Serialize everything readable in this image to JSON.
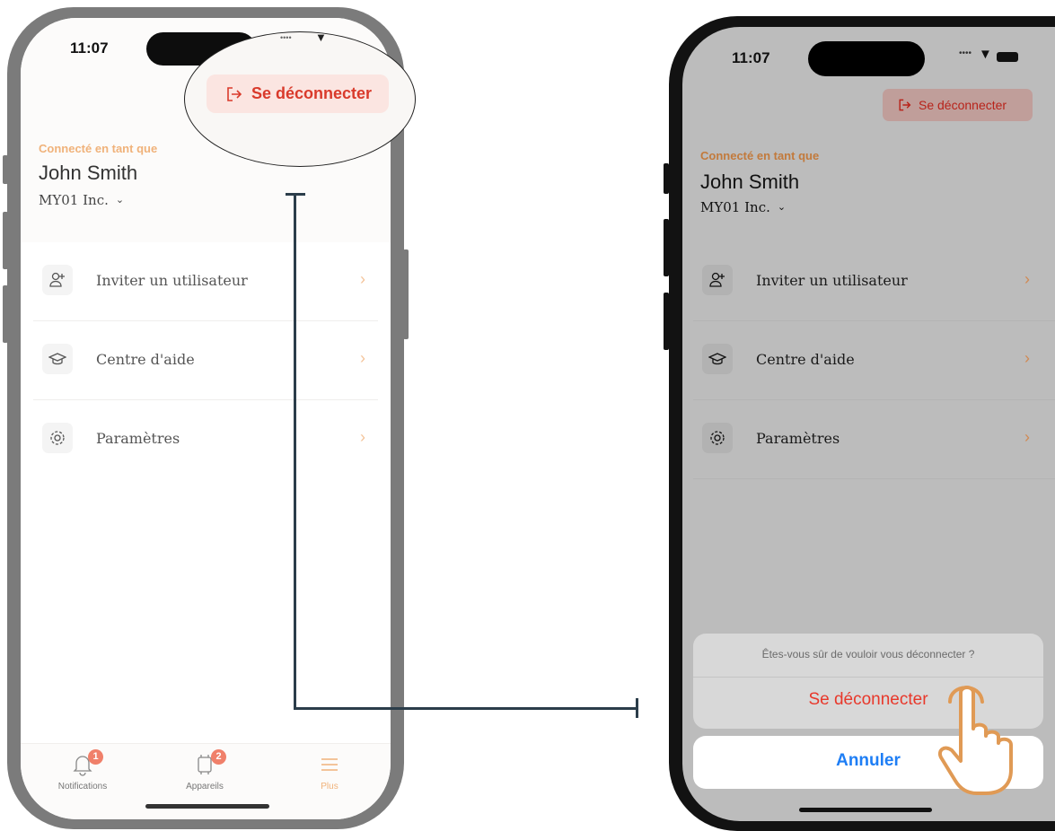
{
  "left_screen": {
    "status_time": "11:07",
    "logout_label": "Se déconnecter",
    "connected_label": "Connecté en tant que",
    "user_name": "John Smith",
    "org_name": "MY01 Inc.",
    "menu": [
      {
        "label": "Inviter un utilisateur",
        "icon": "add-user-icon"
      },
      {
        "label": "Centre d'aide",
        "icon": "graduation-cap-icon"
      },
      {
        "label": "Paramètres",
        "icon": "gear-icon"
      }
    ],
    "tabs": [
      {
        "label": "Notifications",
        "icon": "bell-icon",
        "badge": "1"
      },
      {
        "label": "Appareils",
        "icon": "device-icon",
        "badge": "2"
      },
      {
        "label": "Plus",
        "icon": "menu-icon",
        "active": true
      }
    ],
    "colors": {
      "accent": "#f0b27a",
      "logout_red": "#d93a2b",
      "badge": "#f0806a"
    }
  },
  "right_screen": {
    "status_time": "11:07",
    "logout_label": "Se déconnecter",
    "connected_label": "Connecté en tant que",
    "user_name": "John Smith",
    "org_name": "MY01 Inc.",
    "menu": [
      {
        "label": "Inviter un utilisateur",
        "icon": "add-user-icon"
      },
      {
        "label": "Centre d'aide",
        "icon": "graduation-cap-icon"
      },
      {
        "label": "Paramètres",
        "icon": "gear-icon"
      }
    ],
    "action_sheet": {
      "message": "Êtes-vous sûr de vouloir vous déconnecter ?",
      "confirm_label": "Se déconnecter",
      "cancel_label": "Annuler"
    },
    "colors": {
      "overlay": "#bcbcbc",
      "confirm_red": "#e8382b",
      "cancel_blue": "#1e7ef5",
      "hand": "#e09a55"
    }
  }
}
